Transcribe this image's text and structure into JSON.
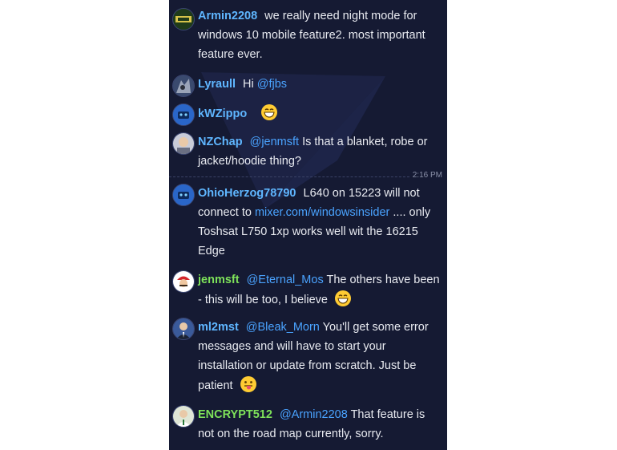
{
  "colors": {
    "background": "#151a33",
    "link": "#4aa3ff",
    "user_blue": "#5fb6ff",
    "user_green": "#7ee25a",
    "text": "#e8eaf0",
    "timestamp": "#8a90a8"
  },
  "timestamp": "2:16 PM",
  "messages": [
    {
      "user": "Armin2208",
      "user_color": "#5fb6ff",
      "avatar": "logo-avatar-icon",
      "lines": [
        "we really need night mode for",
        "windows 10 mobile feature2. most important",
        "feature ever."
      ]
    },
    {
      "user": "Lyraull",
      "user_color": "#5fb6ff",
      "avatar": "wolf-avatar-icon",
      "pre": "Hi ",
      "mention": "@fjbs"
    },
    {
      "user": "kWZippo",
      "user_color": "#5fb6ff",
      "avatar": "robot-avatar-icon",
      "emoji": "grinning-emoji-icon"
    },
    {
      "user": "NZChap",
      "user_color": "#5fb6ff",
      "avatar": "person-avatar-icon",
      "mention": "@jenmsft",
      "after": "Is that a blanket, robe or",
      "line2": "jacket/hoodie thing?"
    },
    {
      "user": "OhioHerzog78790",
      "user_color": "#5fb6ff",
      "avatar": "robot-avatar-icon",
      "line1": "L640 on 15223 will not",
      "pre": "connect to ",
      "link": "mixer.com/windowsinsider",
      "post": " .... only",
      "line3": "Toshsat L750 1xp works well wit the 16215",
      "line4": "Edge"
    },
    {
      "user": "jenmsft",
      "user_color": "#7ee25a",
      "avatar": "mario-avatar-icon",
      "mention": "@Eternal_Mos",
      "after": "The others have been",
      "line2": "- this will be too, I believe",
      "emoji": "grinning-emoji-icon"
    },
    {
      "user": "ml2mst",
      "user_color": "#5fb6ff",
      "avatar": "suit-avatar-icon",
      "mention": "@Bleak_Morn",
      "after": "You'll get some error",
      "line2": "messages and will have to start your",
      "line3": "installation or update from scratch. Just be",
      "line4": "patient",
      "emoji": "tongue-emoji-icon"
    },
    {
      "user": "ENCRYPT512",
      "user_color": "#7ee25a",
      "avatar": "doctor-avatar-icon",
      "mention": "@Armin2208",
      "after": "That feature is",
      "line2": "not on the road map currently, sorry."
    }
  ]
}
